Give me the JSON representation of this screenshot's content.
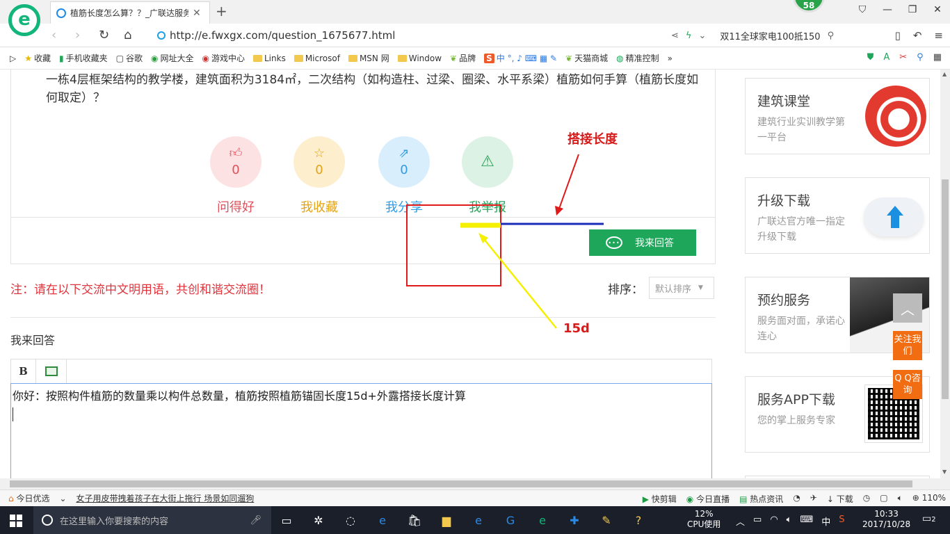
{
  "browser": {
    "tab_title": "植筋长度怎么算？？_广联达服务",
    "url": "http://e.fwxgx.com/question_1675677.html",
    "badge": "58",
    "promo": "双11全球家电100抵150",
    "logo_letter": "e"
  },
  "bookmarks": [
    "收藏",
    "手机收藏夹",
    "谷歌",
    "网址大全",
    "游戏中心",
    "Links",
    "Microsof",
    "MSN 网",
    "Window",
    "品牌",
    "天猫商城",
    "精准控制"
  ],
  "question": {
    "text": "一栋4层框架结构的教学楼，建筑面积为3184㎡，二次结构（如构造柱、过梁、圈梁、水平系梁）植筋如何手算（植筋长度如何取定）？"
  },
  "actions": [
    {
      "label": "问得好",
      "count": "0",
      "icon": "thumbs-up-icon",
      "color": "#e0505a",
      "bg": "#fde2e4"
    },
    {
      "label": "我收藏",
      "count": "0",
      "icon": "star-icon",
      "color": "#e3a318",
      "bg": "#fdeecd"
    },
    {
      "label": "我分享",
      "count": "0",
      "icon": "share-icon",
      "color": "#2e9ce6",
      "bg": "#d9eefc"
    },
    {
      "label": "我举报",
      "count": "",
      "icon": "warning-icon",
      "color": "#26a358",
      "bg": "#dcf2e4"
    }
  ],
  "answer_button": "我来回答",
  "notice": "注：请在以下交流中文明用语，共创和谐交流圈！",
  "sort": {
    "label": "排序：",
    "value": "默认排序"
  },
  "reply_section_title": "我来回答",
  "editor": {
    "bold_label": "B",
    "content": "你好：按照构件植筋的数量乘以构件总数量，植筋按照植筋锚固长度15d+外露搭接长度计算"
  },
  "sidebar": [
    {
      "title": "建筑课堂",
      "sub": "建筑行业实训教学第一平台"
    },
    {
      "title": "升级下载",
      "sub": "广联达官方唯一指定升级下载"
    },
    {
      "title": "预约服务",
      "sub": "服务面对面，承诺心连心"
    },
    {
      "title": "服务APP下载",
      "sub": "您的掌上服务专家"
    }
  ],
  "float_buttons": {
    "follow": "关注我们",
    "qq": "Q Q咨询"
  },
  "annotations": {
    "lap_length": "搭接长度",
    "anchor": "15d"
  },
  "statusbar": {
    "today": "今日优选",
    "news": "女子用皮带拽着孩子在大街上拖行 场景如同遛狗",
    "items": [
      "快剪辑",
      "今日直播",
      "热点资讯",
      "下载",
      "110%"
    ]
  },
  "taskbar": {
    "search_placeholder": "在这里输入你要搜索的内容",
    "cpu_percent": "12%",
    "cpu_label": "CPU使用",
    "ime": "中",
    "time": "10:33",
    "date": "2017/10/28",
    "notifications": "2"
  },
  "colors": {
    "green": "#1ea65a",
    "red": "#e01a1a",
    "blue_line": "#1a2bb8",
    "yellow_line": "#f5ef00"
  }
}
